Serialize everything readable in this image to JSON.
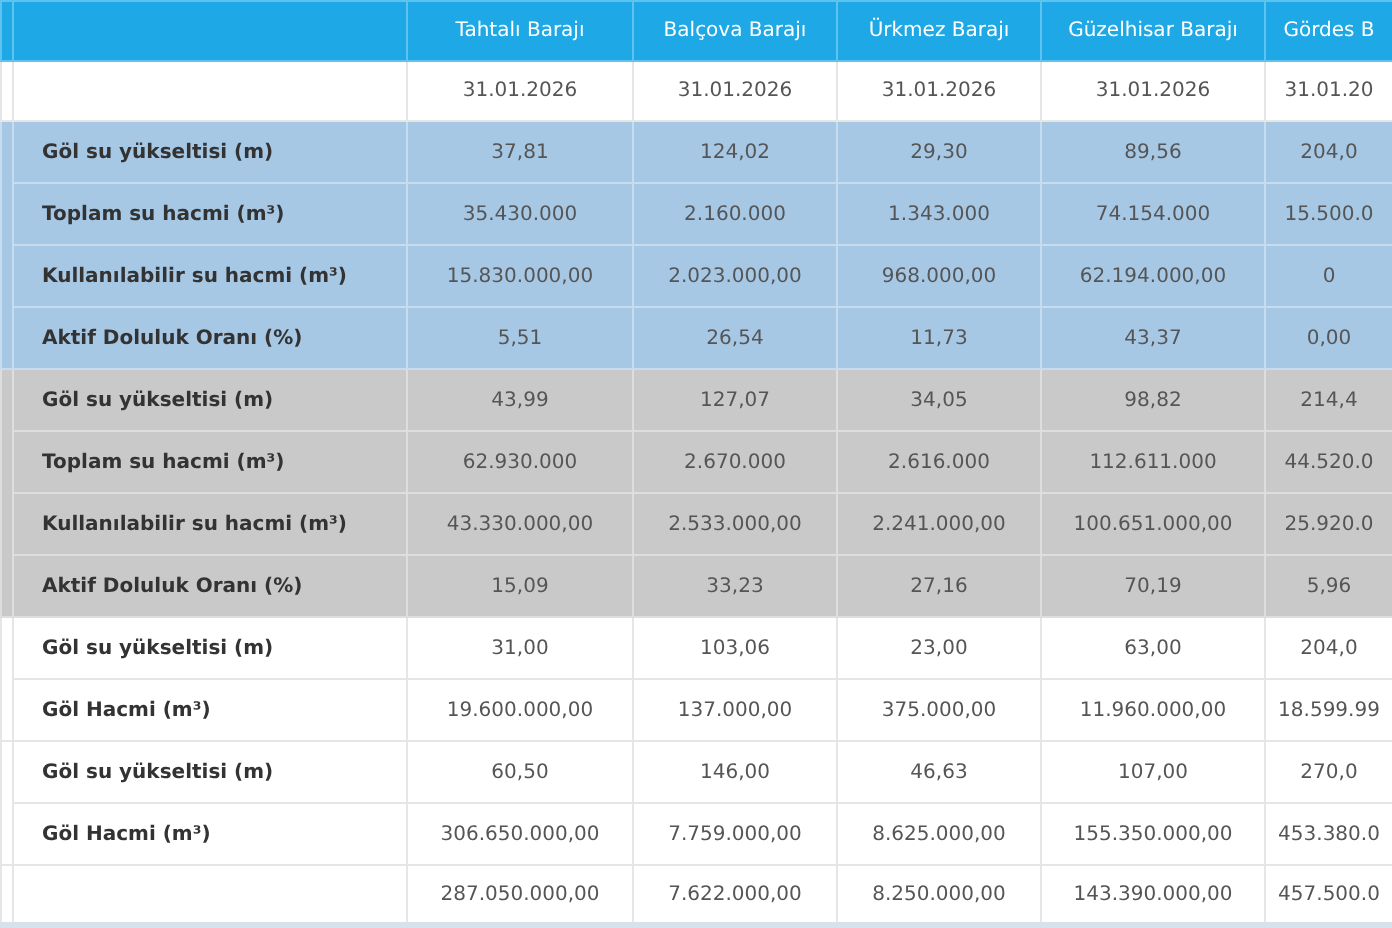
{
  "table": {
    "columns": [
      "Tahtalı Barajı",
      "Balçova Barajı",
      "Ürkmez Barajı",
      "Güzelhisar Barajı",
      "Gördes B"
    ],
    "date_row": [
      "31.01.2026",
      "31.01.2026",
      "31.01.2026",
      "31.01.2026",
      "31.01.20"
    ],
    "groups": [
      {
        "kind": "blue",
        "rows": [
          {
            "label": "Göl su yükseltisi (m)",
            "cells": [
              "37,81",
              "124,02",
              "29,30",
              "89,56",
              "204,0"
            ]
          },
          {
            "label": "Toplam su hacmi (m³)",
            "cells": [
              "35.430.000",
              "2.160.000",
              "1.343.000",
              "74.154.000",
              "15.500.0"
            ]
          },
          {
            "label": "Kullanılabilir su hacmi (m³)",
            "cells": [
              "15.830.000,00",
              "2.023.000,00",
              "968.000,00",
              "62.194.000,00",
              "0"
            ]
          },
          {
            "label": "Aktif Doluluk Oranı (%)",
            "cells": [
              "5,51",
              "26,54",
              "11,73",
              "43,37",
              "0,00"
            ]
          }
        ]
      },
      {
        "kind": "grey",
        "rows": [
          {
            "label": "Göl su yükseltisi (m)",
            "cells": [
              "43,99",
              "127,07",
              "34,05",
              "98,82",
              "214,4"
            ]
          },
          {
            "label": "Toplam su hacmi (m³)",
            "cells": [
              "62.930.000",
              "2.670.000",
              "2.616.000",
              "112.611.000",
              "44.520.0"
            ]
          },
          {
            "label": "Kullanılabilir su hacmi (m³)",
            "cells": [
              "43.330.000,00",
              "2.533.000,00",
              "2.241.000,00",
              "100.651.000,00",
              "25.920.0"
            ]
          },
          {
            "label": "Aktif Doluluk Oranı (%)",
            "cells": [
              "15,09",
              "33,23",
              "27,16",
              "70,19",
              "5,96"
            ]
          }
        ]
      },
      {
        "kind": "plain",
        "rows": [
          {
            "label": "Göl su yükseltisi (m)",
            "cells": [
              "31,00",
              "103,06",
              "23,00",
              "63,00",
              "204,0"
            ]
          },
          {
            "label": "Göl Hacmi (m³)",
            "cells": [
              "19.600.000,00",
              "137.000,00",
              "375.000,00",
              "11.960.000,00",
              "18.599.99"
            ]
          }
        ]
      },
      {
        "kind": "plain",
        "rows": [
          {
            "label": "Göl su yükseltisi (m)",
            "cells": [
              "60,50",
              "146,00",
              "46,63",
              "107,00",
              "270,0"
            ]
          },
          {
            "label": "Göl Hacmi (m³)",
            "cells": [
              "306.650.000,00",
              "7.759.000,00",
              "8.625.000,00",
              "155.350.000,00",
              "453.380.0"
            ]
          }
        ]
      }
    ],
    "total_row": [
      "287.050.000,00",
      "7.622.000,00",
      "8.250.000,00",
      "143.390.000,00",
      "457.500.0"
    ]
  }
}
